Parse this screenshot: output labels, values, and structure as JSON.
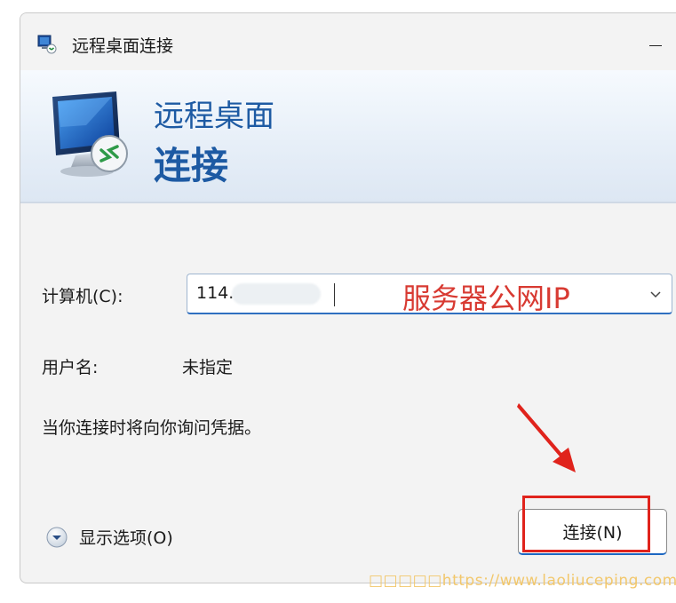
{
  "window": {
    "title": "远程桌面连接",
    "icon": "remote-desktop-icon"
  },
  "banner": {
    "line1": "远程桌面",
    "line2": "连接"
  },
  "form": {
    "computer_label": "计算机(C):",
    "computer_value": "114.",
    "annotation": "服务器公网IP",
    "username_label": "用户名:",
    "username_value": "未指定",
    "prompt": "当你连接时将向你询问凭据。"
  },
  "footer": {
    "options_label": "显示选项(O)",
    "connect_label": "连接(N)"
  },
  "watermark": "□□□□□https://www.laoliuceping.com",
  "colors": {
    "accent": "#1d5aa3",
    "annotation": "#d83a32",
    "highlight": "#e0231c"
  }
}
